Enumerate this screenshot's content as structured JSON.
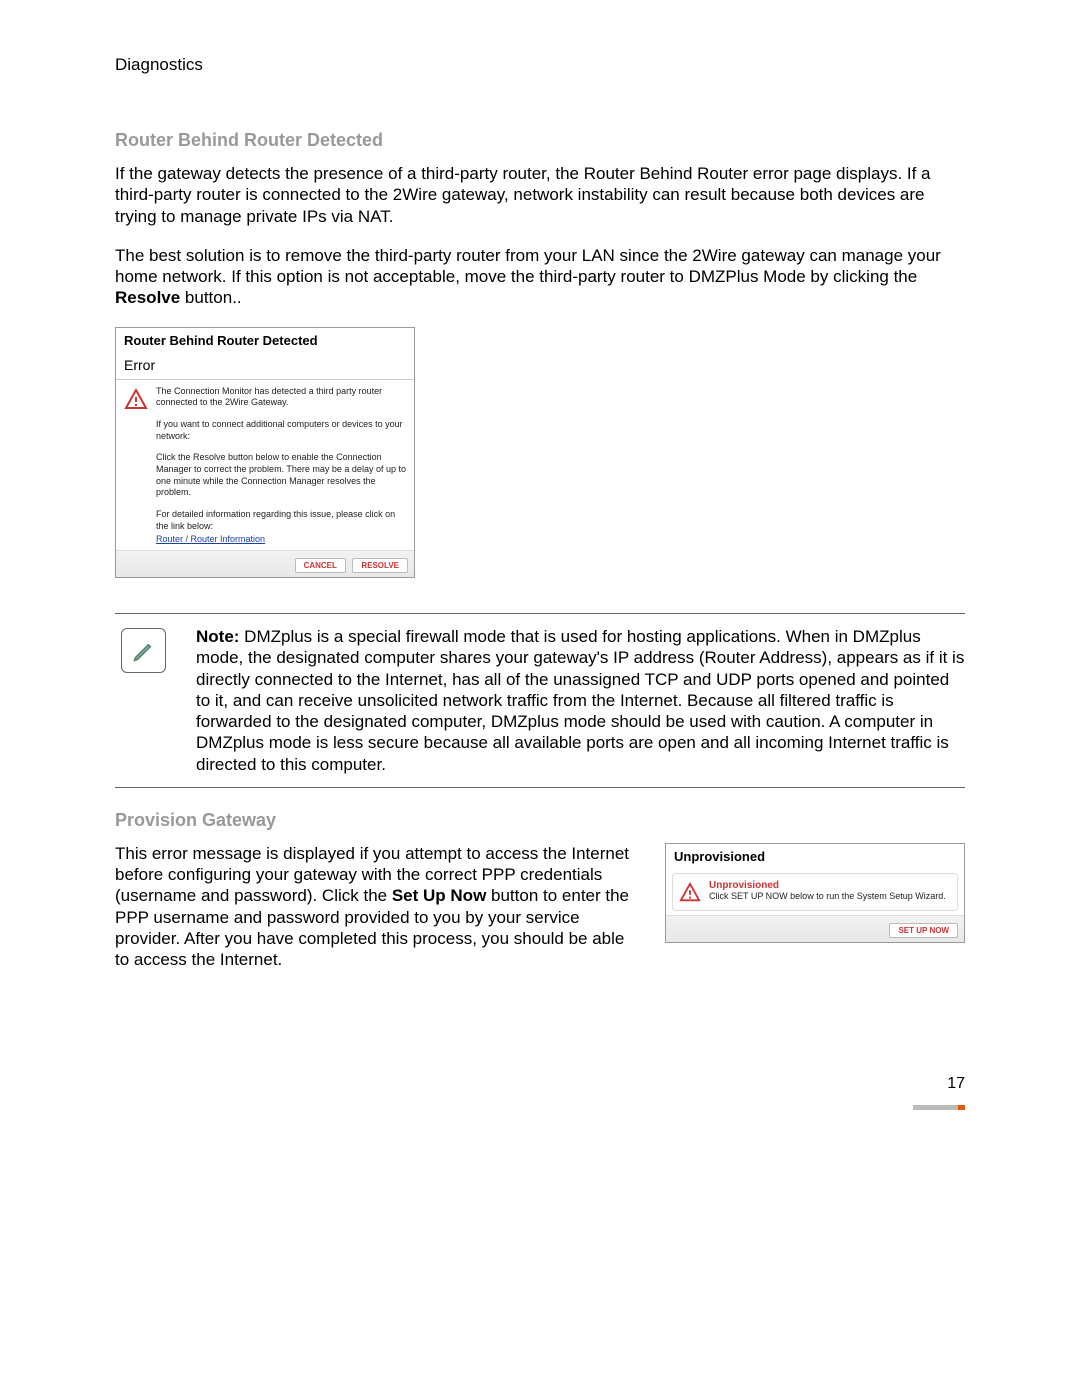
{
  "header": "Diagnostics",
  "section1": {
    "title": "Router Behind Router Detected",
    "p1": "If the gateway detects the presence of a third-party router, the Router Behind Router error page displays. If a third-party router is connected to the 2Wire gateway, network instability can result because both devices are trying to manage private IPs via NAT.",
    "p2a": "The best solution is to remove the third-party router from your LAN since the 2Wire gateway can manage your home network. If this option is not acceptable, move the third-party router to DMZPlus Mode by clicking the ",
    "p2b": "Resolve",
    "p2c": " button.."
  },
  "dialog1": {
    "title": "Router Behind Router Detected",
    "subtitle": "Error",
    "t1": "The Connection Monitor has detected a third party router connected to the 2Wire Gateway.",
    "t2": "If you want to connect additional computers or devices to your network:",
    "t3": "Click the Resolve button below to enable the Connection Manager to correct the problem. There may be a delay of up to one minute while the Connection Manager resolves the problem.",
    "t4": "For detailed information regarding this issue, please click on the link below:",
    "link": "Router / Router Information",
    "cancel": "CANCEL",
    "resolve": "RESOLVE"
  },
  "note": {
    "label": "Note:",
    "body": " DMZplus is a special firewall mode that is used for hosting applications. When in DMZplus mode, the designated computer shares your gateway's IP address (Router Address), appears as if it is directly connected to the Internet, has all of the unassigned TCP and UDP ports opened and pointed to it, and can receive unsolicited network traffic from the Internet. Because all filtered traffic is forwarded to the designated computer, DMZplus mode should be used with caution. A computer in DMZplus mode is less secure because all available ports are open and all incoming Internet traffic is directed to this computer."
  },
  "section2": {
    "title": "Provision Gateway",
    "p1a": "This error message is displayed if you attempt to access the Internet before configuring your gateway with the correct PPP credentials (username and password). Click the ",
    "p1b": "Set Up Now",
    "p1c": " button to enter the PPP username and password provided to you by your service provider. After you have completed this process, you should be able to access the Internet."
  },
  "dialog2": {
    "title": "Unprovisioned",
    "heading": "Unprovisioned",
    "text": "Click SET UP NOW below to run the System Setup Wizard.",
    "button": "SET UP NOW"
  },
  "pageNumber": "17"
}
